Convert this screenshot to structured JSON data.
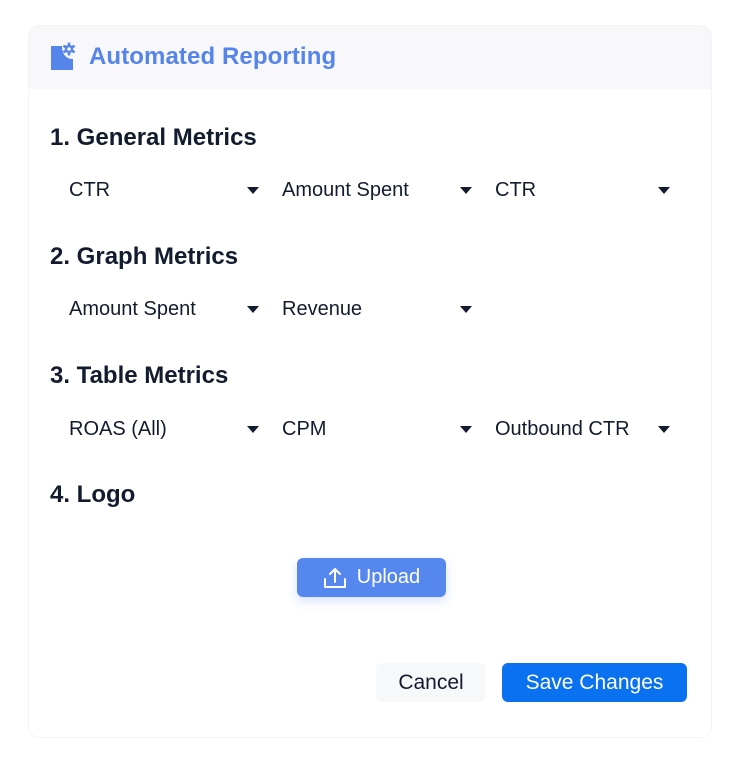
{
  "header": {
    "icon": "report-settings-icon",
    "title": "Automated Reporting"
  },
  "sections": [
    {
      "title": "1. General Metrics",
      "selects": [
        "CTR",
        "Amount Spent",
        "CTR"
      ]
    },
    {
      "title": "2. Graph Metrics",
      "selects": [
        "Amount Spent",
        "Revenue"
      ]
    },
    {
      "title": "3. Table Metrics",
      "selects": [
        "ROAS (All)",
        "CPM",
        "Outbound CTR"
      ]
    },
    {
      "title": "4. Logo"
    }
  ],
  "upload": {
    "icon": "upload-icon",
    "label": "Upload"
  },
  "footer": {
    "cancel_label": "Cancel",
    "save_label": "Save Changes"
  },
  "colors": {
    "accent": "#5585ea",
    "primary_button": "#0a71f0",
    "upload_button": "#5687ef",
    "text": "#131b2f"
  }
}
